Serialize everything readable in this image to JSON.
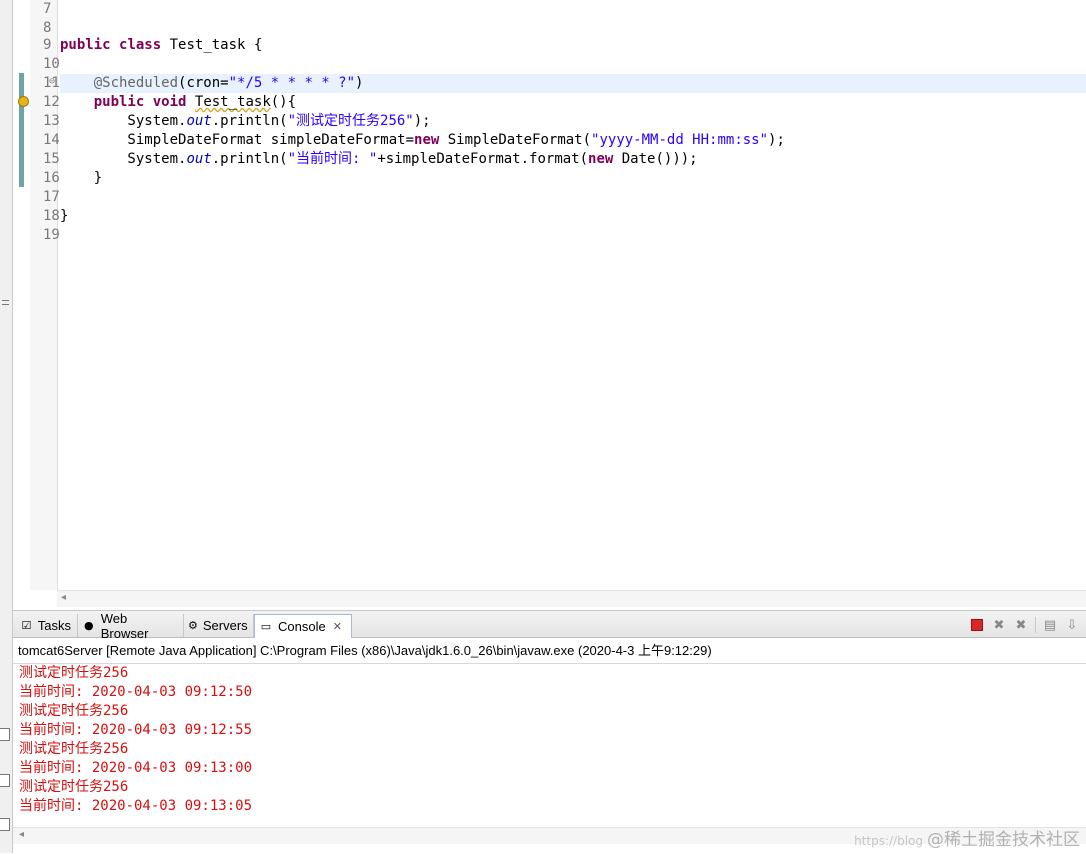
{
  "editor": {
    "lines": [
      {
        "num": "7",
        "text": ""
      },
      {
        "num": "8",
        "text": ""
      },
      {
        "num": "9",
        "text": "public class Test_task {"
      },
      {
        "num": "10",
        "text": ""
      },
      {
        "num": "11",
        "text": "    @Scheduled(cron=\"*/5 * * * * ?\")"
      },
      {
        "num": "12",
        "text": "    public void Test_task(){"
      },
      {
        "num": "13",
        "text": "        System.out.println(\"测试定时任务256\");"
      },
      {
        "num": "14",
        "text": "        SimpleDateFormat simpleDateFormat=new SimpleDateFormat(\"yyyy-MM-dd HH:mm:ss\");"
      },
      {
        "num": "15",
        "text": "        System.out.println(\"当前时间: \"+simpleDateFormat.format(new Date()));"
      },
      {
        "num": "16",
        "text": "    }"
      },
      {
        "num": "17",
        "text": ""
      },
      {
        "num": "18",
        "text": "}"
      },
      {
        "num": "19",
        "text": ""
      }
    ]
  },
  "view_tabs": [
    {
      "label": "Tasks",
      "icon": "tasks-icon"
    },
    {
      "label": "Web Browser",
      "icon": "globe-icon"
    },
    {
      "label": "Servers",
      "icon": "servers-icon"
    },
    {
      "label": "Console",
      "icon": "console-icon",
      "active": true
    }
  ],
  "console": {
    "process_label": "tomcat6Server [Remote Java Application] C:\\Program Files (x86)\\Java\\jdk1.6.0_26\\bin\\javaw.exe (2020-4-3 上午9:12:29)",
    "output": [
      "测试定时任务256",
      "当前时间: 2020-04-03 09:12:50",
      "测试定时任务256",
      "当前时间: 2020-04-03 09:12:55",
      "测试定时任务256",
      "当前时间: 2020-04-03 09:13:00",
      "测试定时任务256",
      "当前时间: 2020-04-03 09:13:05"
    ],
    "output_color": "#d80f0f"
  },
  "watermark": {
    "faint": "https://blog",
    "text": "@稀土掘金技术社区"
  }
}
